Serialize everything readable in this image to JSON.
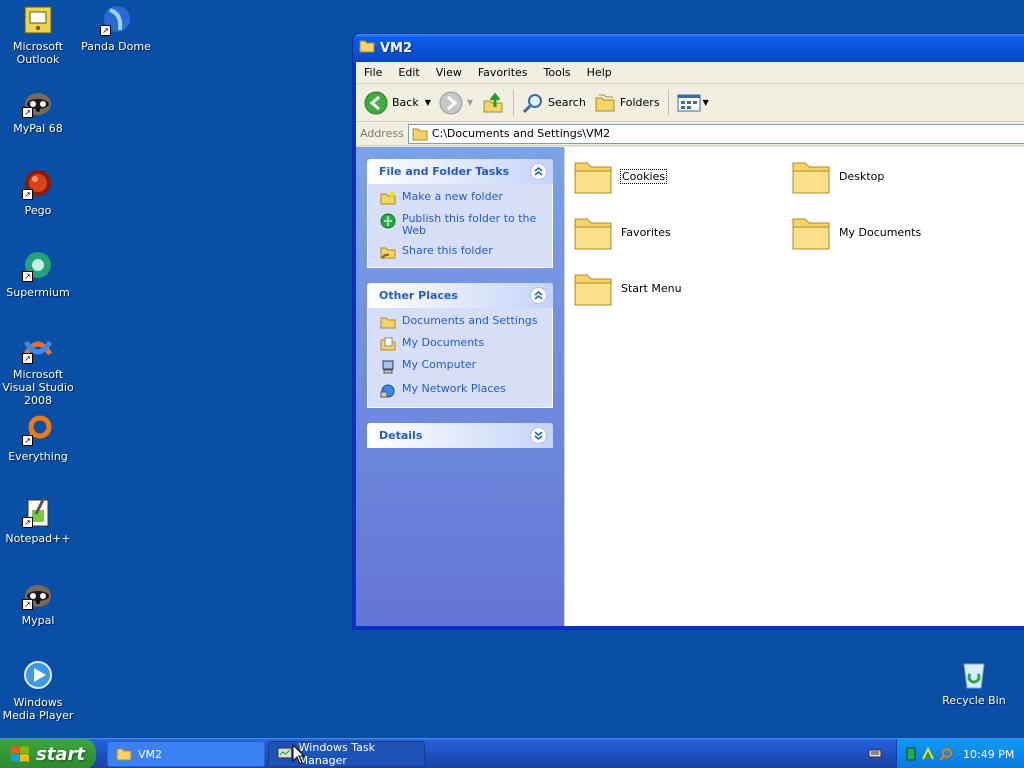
{
  "desktop": {
    "icons": [
      {
        "label": "Microsoft Outlook",
        "icon": "outlook-icon"
      },
      {
        "label": "Panda Dome",
        "icon": "panda-dome-icon"
      },
      {
        "label": "MyPal 68",
        "icon": "mypal-icon"
      },
      {
        "label": "Pego",
        "icon": "pego-icon"
      },
      {
        "label": "Supermium",
        "icon": "supermium-icon"
      },
      {
        "label": "Microsoft Visual Studio 2008",
        "icon": "visual-studio-icon"
      },
      {
        "label": "Everything",
        "icon": "everything-icon"
      },
      {
        "label": "Notepad++",
        "icon": "notepadpp-icon"
      },
      {
        "label": "Mypal",
        "icon": "mypal-icon"
      },
      {
        "label": "Windows Media Player",
        "icon": "media-player-icon"
      },
      {
        "label": "Recycle Bin",
        "icon": "recycle-bin-icon"
      }
    ]
  },
  "window": {
    "title": "VM2",
    "menu": [
      "File",
      "Edit",
      "View",
      "Favorites",
      "Tools",
      "Help"
    ],
    "toolbar": {
      "back": "Back",
      "search": "Search",
      "folders": "Folders"
    },
    "address": {
      "label": "Address",
      "value": "C:\\Documents and Settings\\VM2"
    },
    "taskpane": {
      "file_tasks": {
        "title": "File and Folder Tasks",
        "links": [
          "Make a new folder",
          "Publish this folder to the Web",
          "Share this folder"
        ]
      },
      "other_places": {
        "title": "Other Places",
        "links": [
          "Documents and Settings",
          "My Documents",
          "My Computer",
          "My Network Places"
        ]
      },
      "details": {
        "title": "Details"
      }
    },
    "files": [
      "Cookies",
      "Desktop",
      "Favorites",
      "My Documents",
      "Start Menu"
    ]
  },
  "taskbar": {
    "start": "start",
    "tasks": [
      "VM2",
      "Windows Task Manager"
    ],
    "clock": "10:49 PM"
  },
  "colors": {
    "desktop": "#0a4fa6",
    "link": "#215dc6",
    "start_green": "#379a37"
  }
}
